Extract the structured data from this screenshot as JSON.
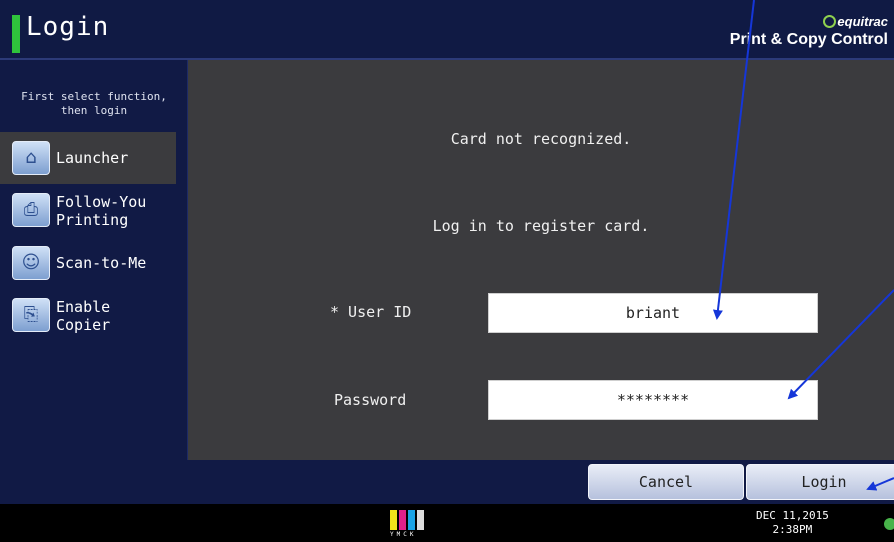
{
  "header": {
    "title": "Login",
    "brand_line1": "equitrac",
    "brand_line2": "Print & Copy Control"
  },
  "sidebar": {
    "hint": "First select function,\nthen login",
    "items": [
      {
        "label": "Launcher",
        "icon": "home-icon",
        "active": true
      },
      {
        "label": "Follow-You\nPrinting",
        "icon": "follow-you-printing-icon",
        "active": false
      },
      {
        "label": "Scan-to-Me",
        "icon": "scan-to-me-icon",
        "active": false
      },
      {
        "label": "Enable\nCopier",
        "icon": "copier-icon",
        "active": false
      }
    ]
  },
  "main": {
    "message1": "Card not recognized.",
    "message2": "Log in to register card.",
    "user_id_label": "* User ID",
    "user_id_value": "briant",
    "password_label": "Password",
    "password_value": "********"
  },
  "buttons": {
    "cancel": "Cancel",
    "login": "Login"
  },
  "status": {
    "toner_letters": "YMCK",
    "date": "DEC  11,2015",
    "time": "2:38PM"
  },
  "colors": {
    "accent_green": "#2fc33c",
    "sidebar_bg": "#111a45",
    "panel_bg": "#3b3b3e",
    "arrow_blue": "#1536d8"
  }
}
